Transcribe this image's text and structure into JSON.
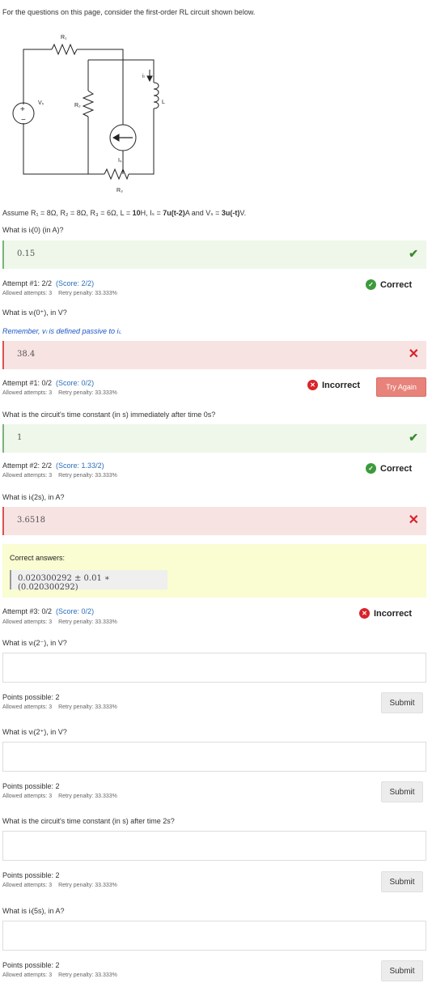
{
  "intro": "For the questions on this page, consider the first-order RL circuit shown below.",
  "circuit": {
    "labels": {
      "r1": "R₁",
      "r2": "R₂",
      "r3": "R₃",
      "vs": "Vₛ",
      "il": "iₗ",
      "l": "L",
      "is": "Iₛ",
      "plus": "+",
      "minus": "−"
    }
  },
  "assume": {
    "prefix": "Assume R₁ = 8Ω, R₂ = 8Ω, R₃ = 6Ω, L = ",
    "l_val": "10",
    "mid1": "H,  Iₛ = ",
    "is_val": "7u(t-2)",
    "mid2": "A  and Vₛ = ",
    "vs_val": "3u(-t)",
    "suffix": "V."
  },
  "questions": [
    {
      "prompt": "What is iₗ(0) (in A)?",
      "answer": "0.15",
      "attempt": "Attempt #1: 2/2",
      "score": "(Score: 2/2)",
      "allowed": "Allowed attempts: 3",
      "penalty": "Retry penalty: 33.333%",
      "status": "Correct"
    },
    {
      "prompt": "What is vₗ(0⁺), in V?",
      "hint": "Remember, vₗ is defined passive to iₗ.",
      "answer": "38.4",
      "attempt": "Attempt #1: 0/2",
      "score": "(Score: 0/2)",
      "allowed": "Allowed attempts: 3",
      "penalty": "Retry penalty: 33.333%",
      "status": "Incorrect",
      "button": "Try Again"
    },
    {
      "prompt": "What is the circuit's time constant (in s) immediately after time 0s?",
      "answer": "1",
      "attempt": "Attempt #2: 2/2",
      "score": "(Score: 1.33/2)",
      "allowed": "Allowed attempts: 3",
      "penalty": "Retry penalty: 33.333%",
      "status": "Correct"
    },
    {
      "prompt": "What is iₗ(2s), in A?",
      "answer": "3.6518",
      "correct_label": "Correct answers:",
      "correct_answer": "0.020300292 ± 0.01 ∗ (0.020300292)",
      "attempt": "Attempt #3: 0/2",
      "score": "(Score: 0/2)",
      "allowed": "Allowed attempts: 3",
      "penalty": "Retry penalty: 33.333%",
      "status": "Incorrect"
    },
    {
      "prompt": "What is vₗ(2⁻), in V?",
      "points": "Points possible: 2",
      "allowed": "Allowed attempts: 3",
      "penalty": "Retry penalty: 33.333%",
      "button": "Submit"
    },
    {
      "prompt": "What is vₗ(2⁺), in V?",
      "points": "Points possible: 2",
      "allowed": "Allowed attempts: 3",
      "penalty": "Retry penalty: 33.333%",
      "button": "Submit"
    },
    {
      "prompt": "What is the circuit's time constant (in s) after time 2s?",
      "points": "Points possible: 2",
      "allowed": "Allowed attempts: 3",
      "penalty": "Retry penalty: 33.333%",
      "button": "Submit"
    },
    {
      "prompt": "What is iₗ(5s), in A?",
      "points": "Points possible: 2",
      "allowed": "Allowed attempts: 3",
      "penalty": "Retry penalty: 33.333%",
      "button": "Submit"
    }
  ],
  "colors": {
    "correct_bg": "#eef7ea",
    "incorrect_bg": "#f8e3e3",
    "check_green": "#3c8a2e",
    "cross_red": "#d9232a",
    "try_again_bg": "#e8837b",
    "correct_answers_bg": "#fafcd2",
    "score_blue": "#2a6ebb",
    "hint_blue": "#1a54c9"
  },
  "icons": {
    "checkmark": "check-icon",
    "cross": "cross-icon",
    "correct_badge": "check-circle-icon",
    "incorrect_badge": "x-circle-icon"
  }
}
